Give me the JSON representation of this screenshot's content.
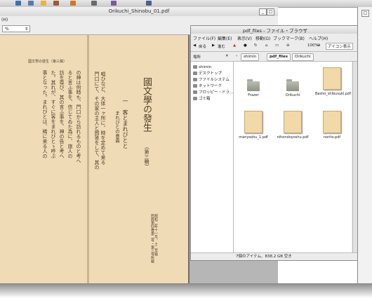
{
  "viewer": {
    "title": "Orikuchi_Shinobu_01.pdf",
    "menu_help": "(H)",
    "zoom": "%"
  },
  "page": {
    "right_page": {
      "title": "國文學の發生",
      "subtitle": "(第三稿)",
      "heading": "一　客とまれびとと",
      "subhead": "まれびとの意義"
    },
    "left_page": {
      "header": "國文學の發生（第三稿）"
    },
    "columns": [
      "唱ひなど、大体一ヶ所に、時を定めて来る",
      "門口にて、その家の主人と問答をして、其の",
      "の神は何時も、門口から訪れるものと考へ",
      "ると言ふ事を、信じてゐた為に、旅人の",
      "訪を尊び、其の言ふ事を、神の告と考へ",
      "た。其れが、すぐに客をまれびとゝ呼ぶ",
      "事となった。まれびとは、稀に来る人の"
    ],
    "footnote": "昭和二年十一月、十二月稿\n民族第四巻第二号・第三号所載"
  },
  "fb": {
    "title": "pdf_files - ファイル・ブラウザ",
    "menu": [
      "ファイル(F)",
      "編集(E)",
      "表示(V)",
      "移動(G)",
      "ブックマーク(B)",
      "ヘルプ(H)"
    ],
    "toolbar": {
      "back": "戻る",
      "forward": "進む",
      "zoom": "100%",
      "view": "アイコン表示"
    },
    "location": {
      "places": "場所",
      "crumbs": [
        "shimin",
        "pdf_files",
        "Orikuchi"
      ]
    },
    "sidebar": [
      "shimin",
      "デスクトップ",
      "ファイルシステム",
      "ネットワーク",
      "フロッピー・ドラ...",
      "ゴミ箱"
    ],
    "files": [
      {
        "name": "Frazer",
        "kind": "folder"
      },
      {
        "name": "Orikuchi",
        "kind": "folder"
      },
      {
        "name": "Basho_shibusuki.pdf",
        "kind": "pdf"
      },
      {
        "name": "manyoshu_1.pdf",
        "kind": "pdf"
      },
      {
        "name": "nihondoyoshu.pdf",
        "kind": "pdf"
      },
      {
        "name": "norito.pdf",
        "kind": "pdf"
      }
    ],
    "status": "7個のアイテム、838.2 GB 空き"
  }
}
